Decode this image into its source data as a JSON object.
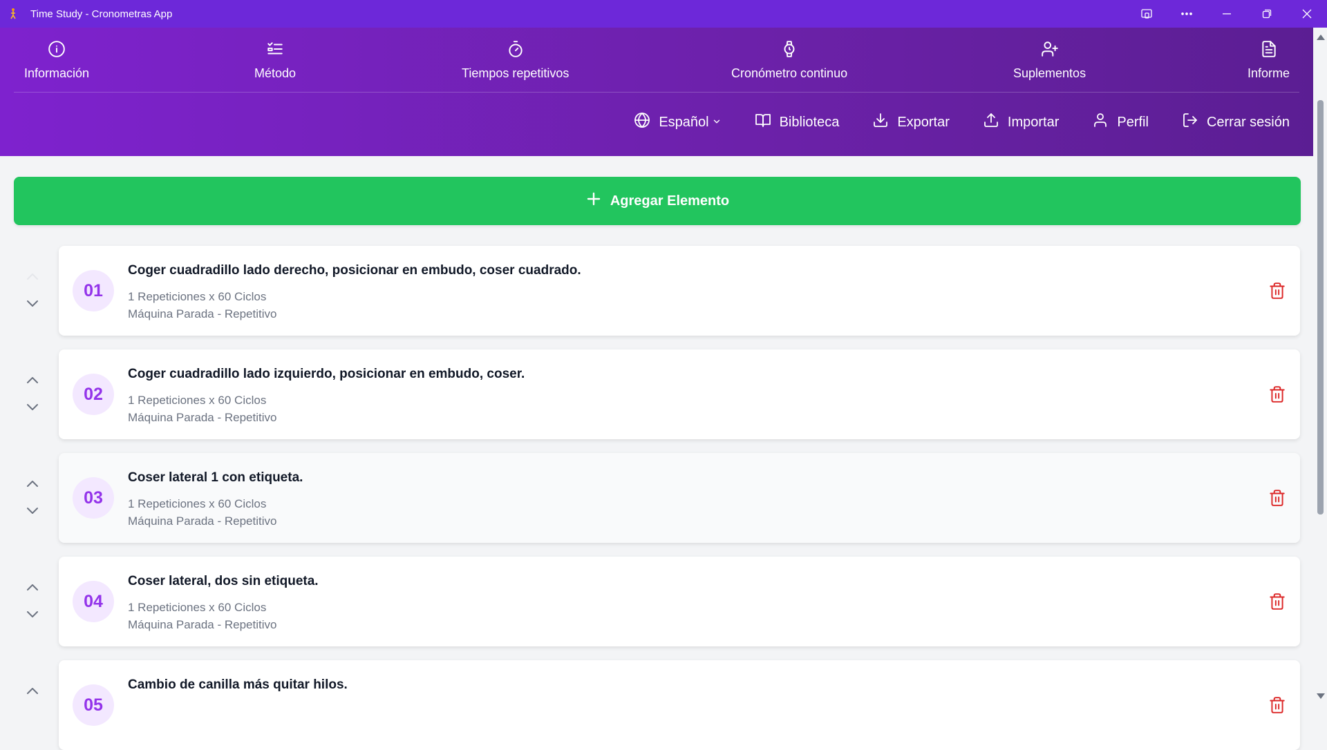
{
  "window": {
    "title": "Time Study - Cronometras App",
    "app_icon": "stopwatch-person-icon",
    "controls": [
      "device-cast-icon",
      "more-icon",
      "minimize-icon",
      "restore-icon",
      "close-icon"
    ]
  },
  "tabs": [
    {
      "label": "Información",
      "icon": "info-icon"
    },
    {
      "label": "Método",
      "icon": "list-check-icon"
    },
    {
      "label": "Tiempos repetitivos",
      "icon": "timer-icon"
    },
    {
      "label": "Cronómetro continuo",
      "icon": "watch-icon"
    },
    {
      "label": "Suplementos",
      "icon": "user-plus-icon"
    },
    {
      "label": "Informe",
      "icon": "document-icon"
    }
  ],
  "actions": {
    "language": "Español",
    "library": "Biblioteca",
    "export": "Exportar",
    "import": "Importar",
    "profile": "Perfil",
    "logout": "Cerrar sesión"
  },
  "add_button": {
    "label": "Agregar Elemento"
  },
  "elements": [
    {
      "number": "01",
      "name": "Coger cuadradillo lado derecho, posicionar en embudo, coser cuadrado.",
      "reps": "1 Repeticiones x 60 Ciclos",
      "type": "Máquina Parada - Repetitivo"
    },
    {
      "number": "02",
      "name": "Coger cuadradillo lado izquierdo, posicionar en embudo, coser.",
      "reps": "1 Repeticiones x 60 Ciclos",
      "type": "Máquina Parada - Repetitivo"
    },
    {
      "number": "03",
      "name": "Coser lateral 1 con etiqueta.",
      "reps": "1 Repeticiones x 60 Ciclos",
      "type": "Máquina Parada - Repetitivo"
    },
    {
      "number": "04",
      "name": "Coser lateral, dos sin etiqueta.",
      "reps": "1 Repeticiones x 60 Ciclos",
      "type": "Máquina Parada - Repetitivo"
    },
    {
      "number": "05",
      "name": "Cambio de canilla más quitar hilos.",
      "reps": "",
      "type": ""
    }
  ],
  "colors": {
    "titlebar": "#6d28d9",
    "header_start": "#7e22ce",
    "header_end": "#5b1e93",
    "add_button": "#22c55e",
    "number_bg": "#f3e8ff",
    "number_text": "#9333ea",
    "trash": "#dc2626"
  }
}
